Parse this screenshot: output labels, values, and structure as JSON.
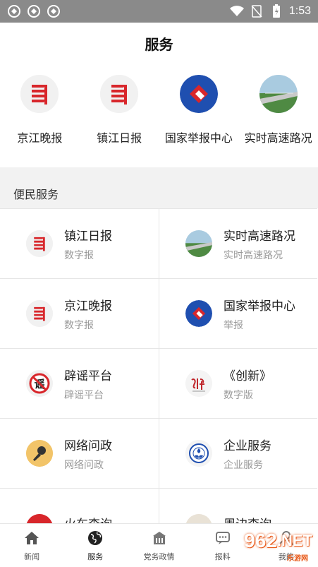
{
  "status_bar": {
    "time": "1:53"
  },
  "header": {
    "title": "服务"
  },
  "quick_links": [
    {
      "label": "京江晚报",
      "icon": "jjwb-logo"
    },
    {
      "label": "镇江日报",
      "icon": "zjrb-logo"
    },
    {
      "label": "国家举报中心",
      "icon": "report-center-logo"
    },
    {
      "label": "实时高速路况",
      "icon": "highway-logo"
    }
  ],
  "section": {
    "title": "便民服务"
  },
  "services": [
    {
      "title": "镇江日报",
      "subtitle": "数字报",
      "icon": "zjrb-logo"
    },
    {
      "title": "实时高速路况",
      "subtitle": "实时高速路况",
      "icon": "highway-logo"
    },
    {
      "title": "京江晚报",
      "subtitle": "数字报",
      "icon": "jjwb-logo"
    },
    {
      "title": "国家举报中心",
      "subtitle": "举报",
      "icon": "report-center-logo"
    },
    {
      "title": "辟谣平台",
      "subtitle": "辟谣平台",
      "icon": "rumor-logo"
    },
    {
      "title": "《创新》",
      "subtitle": "数字版",
      "icon": "innovation-logo"
    },
    {
      "title": "网络问政",
      "subtitle": "网络问政",
      "icon": "microphone-icon"
    },
    {
      "title": "企业服务",
      "subtitle": "企业服务",
      "icon": "enterprise-logo"
    },
    {
      "title": "火车查询",
      "subtitle": "",
      "icon": "train-icon"
    },
    {
      "title": "周边查询",
      "subtitle": "",
      "icon": "nearby-icon"
    }
  ],
  "tabs": [
    {
      "label": "新闻",
      "icon": "home-icon"
    },
    {
      "label": "服务",
      "icon": "globe-icon",
      "active": true
    },
    {
      "label": "党务政情",
      "icon": "building-icon"
    },
    {
      "label": "报料",
      "icon": "chat-icon"
    },
    {
      "label": "我的",
      "icon": "user-icon"
    }
  ],
  "watermark": {
    "text": "962",
    "suffix": ".NET",
    "sub": "乐游网"
  },
  "colors": {
    "status_bar": "#8a8a8a",
    "section_bg": "#f2f2f2",
    "accent_red": "#d8262b",
    "accent_blue": "#1f4fb0"
  }
}
